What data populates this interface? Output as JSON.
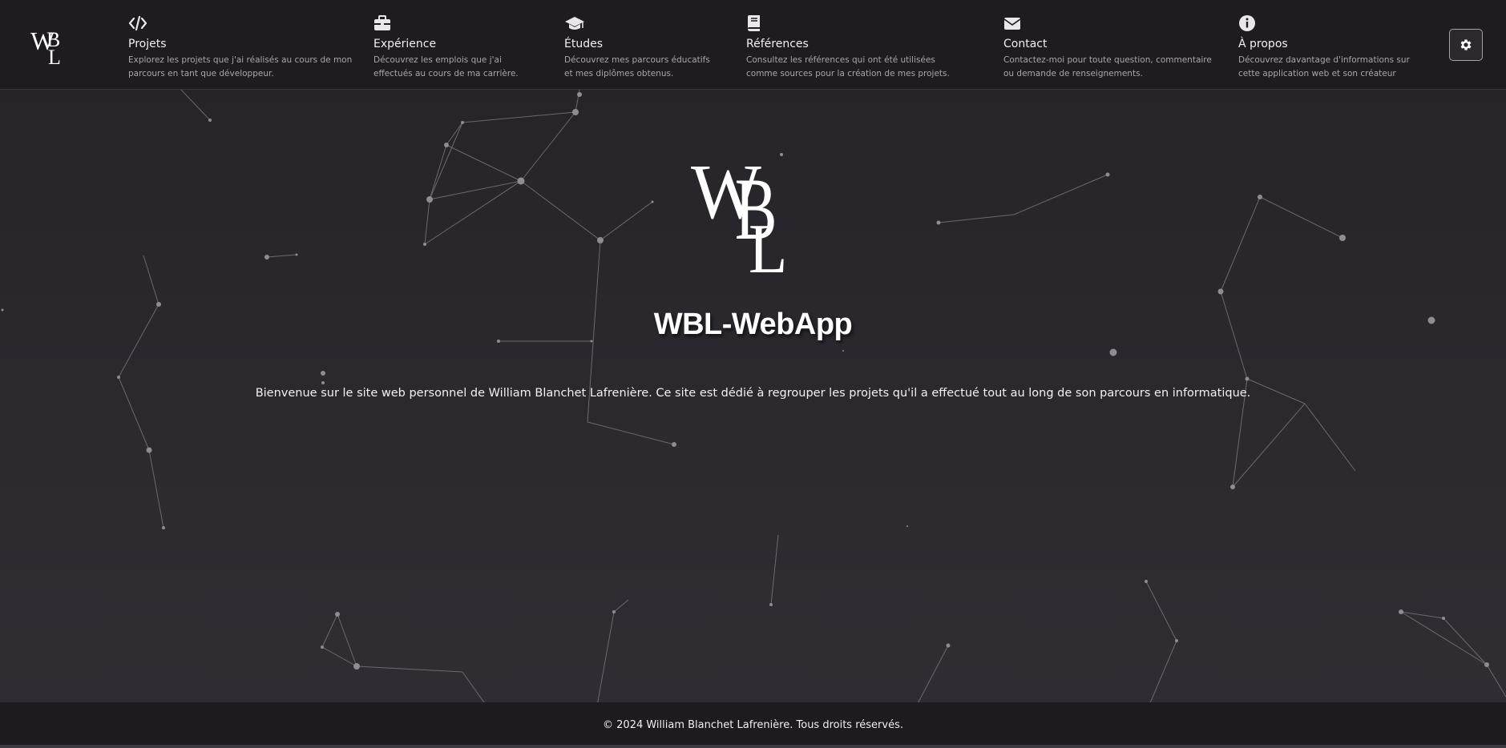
{
  "brand": {
    "logo": "WBL-monogram"
  },
  "nav": {
    "items": [
      {
        "icon": "code-icon",
        "title": "Projets",
        "desc": "Explorez les projets que j'ai réalisés au cours de mon parcours en tant que développeur."
      },
      {
        "icon": "briefcase-icon",
        "title": "Expérience",
        "desc": "Découvrez les emplois que j'ai effectués au cours de ma carrière."
      },
      {
        "icon": "graduation-cap-icon",
        "title": "Études",
        "desc": "Découvrez mes parcours éducatifs et mes diplômes obtenus."
      },
      {
        "icon": "book-icon",
        "title": "Références",
        "desc": "Consultez les références qui ont été utilisées comme sources pour la création de mes projets."
      },
      {
        "icon": "envelope-icon",
        "title": "Contact",
        "desc": "Contactez-moi pour toute question, commentaire ou demande de renseignements."
      },
      {
        "icon": "info-circle-icon",
        "title": "À propos",
        "desc": "Découvrez davantage d'informations sur cette application web et son créateur"
      }
    ],
    "settings_icon": "gear-icon"
  },
  "hero": {
    "title": "WBL-WebApp",
    "text": "Bienvenue sur le site web personnel de William Blanchet Lafrenière. Ce site est dédié à regrouper les projets qu'il a effectué tout au long de son parcours en informatique."
  },
  "footer": {
    "text": "© 2024 William Blanchet Lafrenière. Tous droits réservés."
  },
  "colors": {
    "background": "#2a272d",
    "navbar": "#1e1c21",
    "footer": "#1d1b20",
    "particle": "#8a878e"
  }
}
